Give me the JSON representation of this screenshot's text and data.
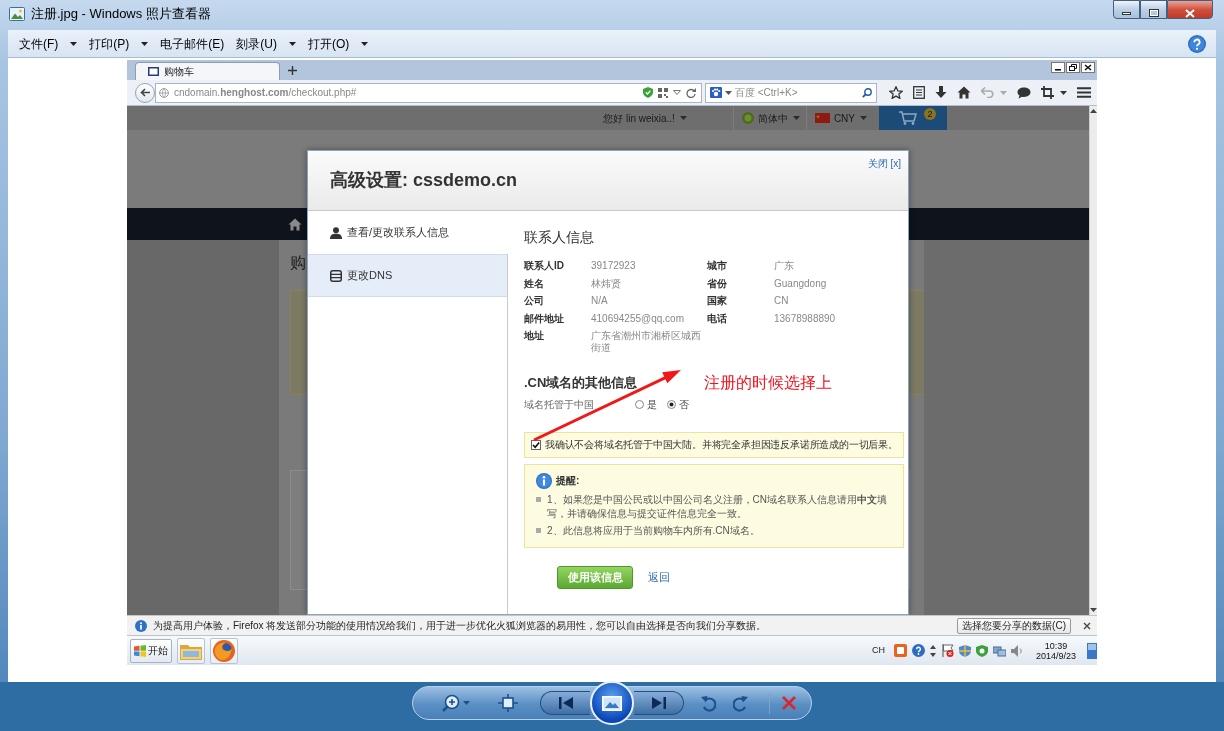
{
  "window": {
    "title": "注册.jpg - Windows 照片查看器"
  },
  "menu": [
    {
      "label": "文件(F)",
      "has_dropdown": true
    },
    {
      "label": "打印(P)",
      "has_dropdown": true
    },
    {
      "label": "电子邮件(E)",
      "has_dropdown": false
    },
    {
      "label": "刻录(U)",
      "has_dropdown": true
    },
    {
      "label": "打开(O)",
      "has_dropdown": true
    }
  ],
  "browser": {
    "tabs": [
      {
        "label": "购物车",
        "selected": true
      }
    ],
    "address": "cndomain.**henghost.com**/checkout.php#",
    "search": {
      "placeholder": "百度 <Ctrl+K>"
    }
  },
  "site": {
    "greeting": "您好 lin weixia..!",
    "language": "简体中",
    "currency": "CNY",
    "cart_count": "2",
    "page_title": "购"
  },
  "modal": {
    "title": "高级设置: cssdemo.cn",
    "close": "关闭 [x]",
    "sidebar": [
      {
        "label": "查看/更改联系人信息",
        "kind": "contact",
        "selected": true
      },
      {
        "label": "更改DNS",
        "kind": "dns",
        "selected": false
      }
    ],
    "contact": {
      "heading": "联系人信息",
      "rows": [
        {
          "left": {
            "label": "联系人ID",
            "value": "39172923"
          },
          "right": {
            "label": "城市",
            "value": "广东"
          }
        },
        {
          "left": {
            "label": "姓名",
            "value": "林炜贤"
          },
          "right": {
            "label": "省份",
            "value": "Guangdong"
          }
        },
        {
          "left": {
            "label": "公司",
            "value": "N/A"
          },
          "right": {
            "label": "国家",
            "value": "CN"
          }
        },
        {
          "left": {
            "label": "邮件地址",
            "value": "410694255@qq.com"
          },
          "right": {
            "label": "电话",
            "value": "13678988890"
          }
        },
        {
          "left": {
            "label": "地址",
            "value": "广东省潮州市湘桥区城西街道"
          }
        }
      ]
    },
    "other": {
      "heading": ".CN域名的其他信息",
      "question": "域名托管于中国",
      "options": [
        {
          "label": "是",
          "selected": false
        },
        {
          "label": "否",
          "selected": true
        }
      ],
      "confirm": {
        "text": "我确认不会将域名托管于中国大陆。并将完全承担因违反承诺所造成的一切后果。",
        "checked": true
      },
      "notice": {
        "title": "提醒:",
        "items": [
          "1、如果您是中国公民或以中国公司名义注册，CN域名联系人信息请用**中文**填写，并请确保信息与提交证件信息完全一致。",
          "2、此信息将应用于当前购物车内所有.CN域名。"
        ]
      }
    },
    "actions": {
      "submit": "使用该信息",
      "back": "返回"
    }
  },
  "annotation": {
    "text": "注册的时候选择上"
  },
  "notification": {
    "text": "为提高用户体验，Firefox 将发送部分功能的使用情况给我们，用于进一步优化火狐浏览器的易用性，您可以自由选择是否向我们分享数据。",
    "button": "选择您要分享的数据(C)"
  },
  "taskbar": {
    "start": "开始",
    "language": "CH",
    "time": "10:39",
    "date": "2014/9/23"
  }
}
